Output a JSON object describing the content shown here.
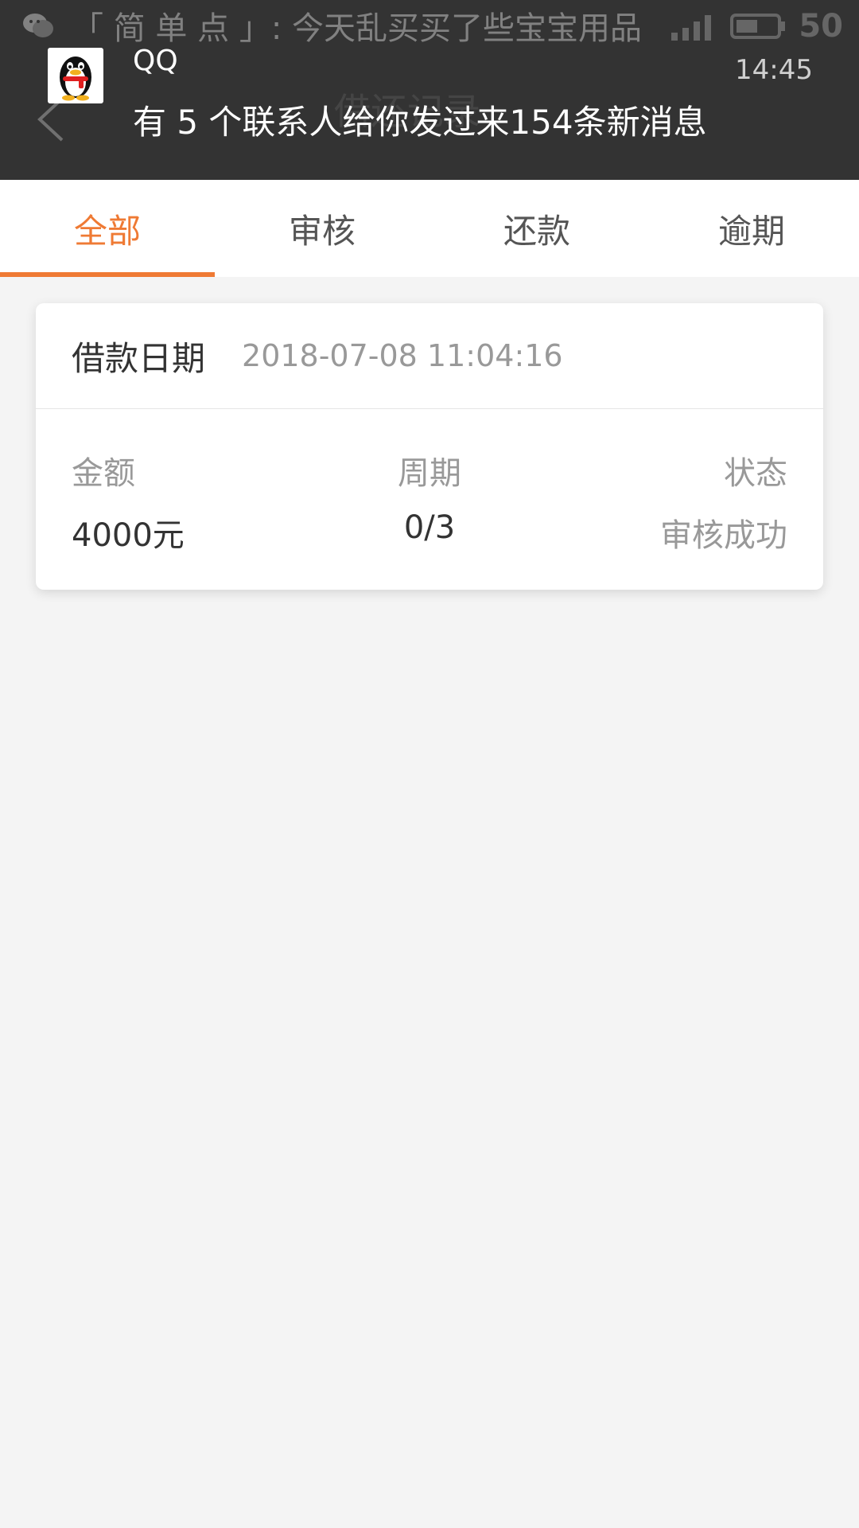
{
  "status_bar": {
    "ticker_text": "「 简 单 点 」: 今天乱买买了些宝宝用品",
    "battery_text": "50",
    "ticker_icon": "wechat-icon"
  },
  "header": {
    "title": "借还记录",
    "back_icon": "chevron-left-icon"
  },
  "notification": {
    "app_name": "QQ",
    "time": "14:45",
    "message": "有 5 个联系人给你发过来154条新消息",
    "icon": "qq-penguin-icon"
  },
  "tabs": [
    {
      "label": "全部",
      "active": true
    },
    {
      "label": "审核",
      "active": false
    },
    {
      "label": "还款",
      "active": false
    },
    {
      "label": "逾期",
      "active": false
    }
  ],
  "record": {
    "date_label": "借款日期",
    "date_value": "2018-07-08 11:04:16",
    "amount_label": "金额",
    "amount_value": "4000元",
    "period_label": "周期",
    "period_value": "0/3",
    "status_label": "状态",
    "status_value": "审核成功"
  },
  "colors": {
    "accent": "#ef7a34",
    "header_bg": "#333333",
    "page_bg": "#f4f4f4"
  }
}
